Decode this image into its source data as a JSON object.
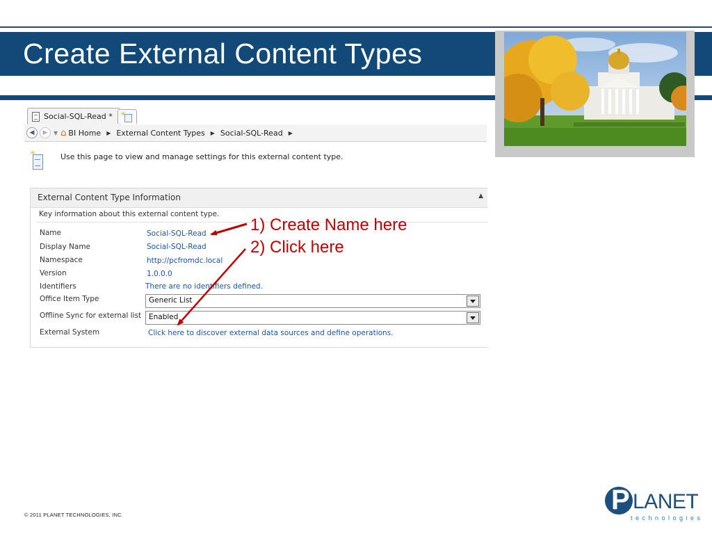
{
  "slide": {
    "title": "Create External Content Types",
    "copyright": "© 2011  PLANET  TECHNOLOGIES,  INC.",
    "logo": {
      "letter": "P",
      "word": "LANET",
      "subtitle": "technologies"
    },
    "photo": "state capitol building with autumn trees"
  },
  "browser": {
    "tab_label": "Social-SQL-Read *",
    "breadcrumbs": [
      "BI Home",
      "External Content Types",
      "Social-SQL-Read"
    ],
    "icons": {
      "back": "back-arrow-icon",
      "forward": "forward-arrow-icon",
      "home": "home-icon"
    }
  },
  "page": {
    "intro": "Use this page to view and manage settings for this external content type.",
    "section": {
      "title": "External Content Type Information",
      "description": "Key information about this external content type."
    },
    "fields": {
      "name": {
        "label": "Name",
        "value": "Social-SQL-Read"
      },
      "display_name": {
        "label": "Display Name",
        "value": "Social-SQL-Read"
      },
      "namespace": {
        "label": "Namespace",
        "value": "http://pcfromdc.local"
      },
      "version": {
        "label": "Version",
        "value": "1.0.0.0"
      },
      "identifiers": {
        "label": "Identifiers",
        "value": "There are no identifiers defined."
      },
      "office_item_type": {
        "label": "Office Item Type",
        "value": "Generic List"
      },
      "offline_sync": {
        "label": "Offline Sync for external list",
        "value": "Enabled"
      },
      "external_system": {
        "label": "External System",
        "value": "Click here to discover external data sources and define operations."
      }
    }
  },
  "annotations": {
    "step1": "1) Create Name here",
    "step2": "2) Click here",
    "color": "#c00000"
  },
  "colors": {
    "banner": "#114a79",
    "link": "#1a56a8"
  }
}
